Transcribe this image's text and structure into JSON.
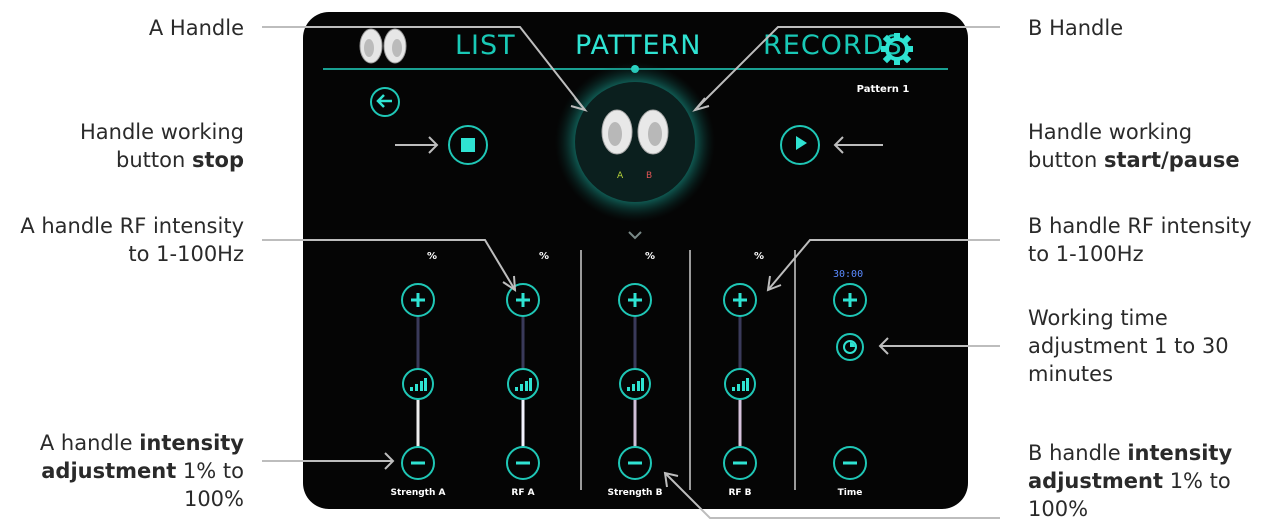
{
  "annotations": {
    "a_handle": "A Handle",
    "b_handle": "B Handle",
    "stop_line1": "Handle working",
    "stop_line2_pre": "button ",
    "stop_line2_bold": "stop",
    "start_line1": "Handle working",
    "start_line2_pre": "button ",
    "start_line2_bold": "start/pause",
    "a_rf_line1": "A handle RF intensity",
    "a_rf_line2": "to 1-100Hz",
    "b_rf_line1": "B handle RF intensity",
    "b_rf_line2": "to 1-100Hz",
    "time_line1": "Working time",
    "time_line2": "adjustment 1 to 30",
    "time_line3": "minutes",
    "a_int_line1_pre": "A handle ",
    "a_int_line1_bold": "intensity",
    "a_int_line2_bold": "adjustment",
    "a_int_line2_post": " 1% to",
    "a_int_line3": "100%",
    "b_int_line1_pre": "B handle ",
    "b_int_line1_bold": "intensity",
    "b_int_line2_bold": "adjustment",
    "b_int_line2_post": " 1% to",
    "b_int_line3": "100%"
  },
  "app": {
    "tabs": {
      "list": "LIST",
      "pattern": "PATTERN",
      "records": "RECORDS"
    },
    "active_tab": "PATTERN",
    "pattern_name": "Pattern 1",
    "handle_labels": {
      "a": "A",
      "b": "B"
    },
    "timer": "30:00",
    "sliders": [
      {
        "label": "Strength A",
        "unit": "%"
      },
      {
        "label": "RF A",
        "unit": "%"
      },
      {
        "label": "Strength B",
        "unit": "%"
      },
      {
        "label": "RF B",
        "unit": "%"
      },
      {
        "label": "Time",
        "unit": ""
      }
    ]
  },
  "colors": {
    "accent": "#1fc7b6",
    "accent_glow": "#2fe3d2",
    "screen_bg": "#050505",
    "handle_a": "#b5d33a",
    "handle_b": "#e05555"
  },
  "icons": {
    "settings": "gear-icon",
    "back": "arrow-left-icon",
    "stop": "stop-icon",
    "play": "play-icon",
    "plus": "plus-icon",
    "minus": "minus-icon",
    "signal": "signal-bars-icon",
    "clock": "clock-icon",
    "expand": "chevron-down-icon"
  }
}
